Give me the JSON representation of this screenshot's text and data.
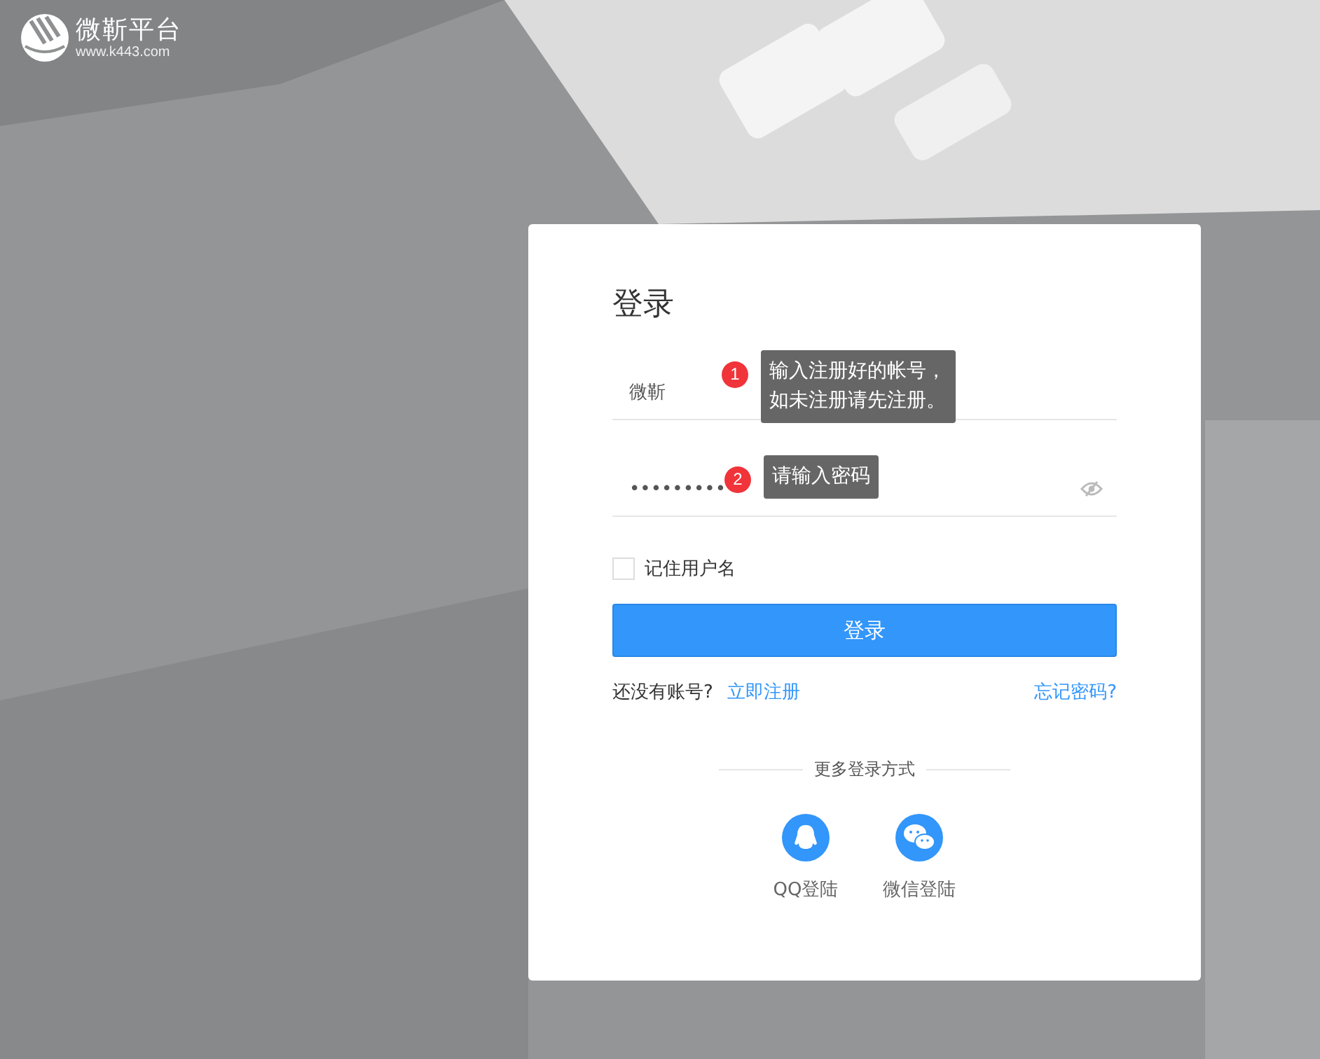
{
  "logo": {
    "name": "微靳平台",
    "url": "www.k443.com"
  },
  "login": {
    "title": "登录",
    "username": {
      "value": "微靳",
      "badge": "1",
      "tooltip": "输入注册好的帐号，如未注册请先注册。"
    },
    "password": {
      "value": "•••••••••",
      "badge": "2",
      "tooltip": "请输入密码"
    },
    "remember": {
      "label": "记住用户名",
      "checked": false
    },
    "submit": "登录",
    "no_account": "还没有账号?",
    "register": "立即注册",
    "forgot": "忘记密码?",
    "more_label": "更多登录方式",
    "social": [
      {
        "kind": "qq",
        "label": "QQ登陆"
      },
      {
        "kind": "wechat",
        "label": "微信登陆"
      }
    ]
  }
}
